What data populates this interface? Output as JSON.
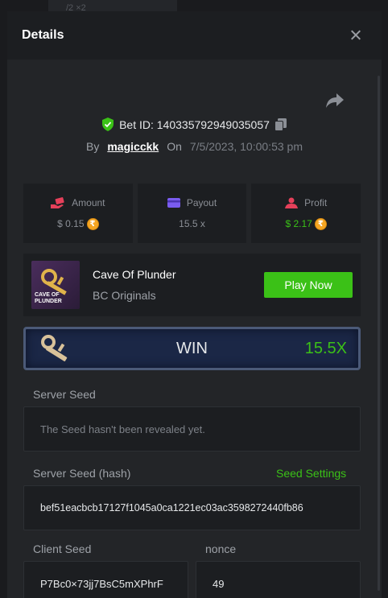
{
  "modal": {
    "title": "Details"
  },
  "bet": {
    "id_text": "Bet ID: 140335792949035057",
    "by_label": "By",
    "username": "magicckk",
    "on_label": "On",
    "date": "7/5/2023, 10:00:53 pm"
  },
  "stats": {
    "amount": {
      "label": "Amount",
      "value": "$ 0.15",
      "icon": "money-hand-icon",
      "color": "#e5405a"
    },
    "payout": {
      "label": "Payout",
      "value": "15.5 x",
      "icon": "card-icon",
      "color": "#7a5cf0"
    },
    "profit": {
      "label": "Profit",
      "value": "$ 2.17",
      "icon": "profit-user-icon",
      "color": "#e5405a"
    }
  },
  "coin_symbol": "₹",
  "game": {
    "thumb_text_line1": "CAVE OF",
    "thumb_text_line2": "PLUNDER",
    "name": "Cave Of Plunder",
    "provider": "BC Originals",
    "play_label": "Play Now"
  },
  "result": {
    "label": "WIN",
    "multiplier": "15.5X"
  },
  "server_seed": {
    "label": "Server Seed",
    "value": "The Seed hasn't been revealed yet."
  },
  "server_seed_hash": {
    "label": "Server Seed (hash)",
    "settings_label": "Seed Settings",
    "value": "bef51eacbcb17127f1045a0ca1221ec03ac3598272440fb86"
  },
  "client_seed": {
    "label": "Client Seed",
    "value": "P7Bc0×73jj7BsC5mXPhrF"
  },
  "nonce": {
    "label": "nonce",
    "value": "49"
  },
  "background": {
    "top_text": "/2  ×2",
    "top_zero": "0"
  },
  "colors": {
    "accent_green": "#3bc117",
    "win_banner": "#1b2746",
    "modal_bg": "#232528"
  }
}
